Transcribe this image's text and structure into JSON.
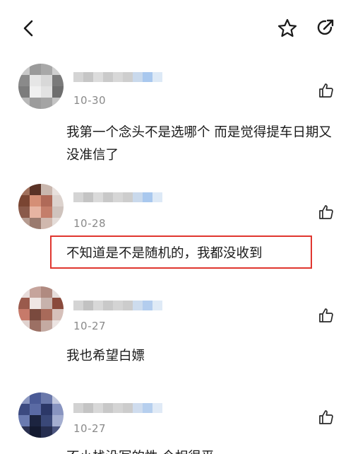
{
  "header": {
    "back_icon": "chevron-left-icon",
    "star_icon": "star-outline-icon",
    "share_icon": "share-arrow-icon"
  },
  "comments": [
    {
      "date": "10-30",
      "text": "我第一个念头不是选哪个  而是觉得提车日期又没准信了",
      "avatar_colors": [
        "#d9d9d9",
        "#8c8c8c",
        "#6b6b6b",
        "#cfcfcf"
      ]
    },
    {
      "date": "10-28",
      "text": "不知道是不是随机的，我都没收到",
      "avatar_colors": [
        "#c99a8a",
        "#7a4a3a",
        "#e8d3c8",
        "#b8a79f"
      ]
    },
    {
      "date": "10-27",
      "text": "我也希望白嫖",
      "avatar_colors": [
        "#d8c4c0",
        "#8b5a4e",
        "#e2d8d6",
        "#a38a80"
      ]
    },
    {
      "date": "10-27",
      "text": "不小栈没写的性    今相很平",
      "avatar_colors": [
        "#4a5a8c",
        "#1c2440",
        "#7a88b8",
        "#2f3a66"
      ]
    }
  ],
  "highlight_color": "#e0362f",
  "like_icon": "thumbs-up-icon"
}
